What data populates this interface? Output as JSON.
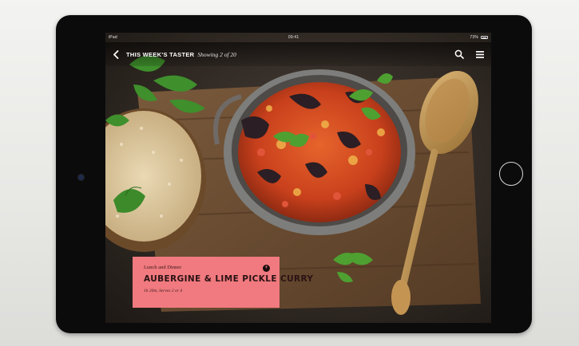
{
  "status_bar": {
    "carrier": "iPad",
    "time": "09:41",
    "battery": "73%"
  },
  "nav": {
    "title": "THIS WEEK'S TASTER",
    "subtitle": "Showing 2 of 20",
    "back_icon": "chevron-left-icon",
    "search_icon": "search-icon",
    "menu_icon": "hamburger-menu-icon"
  },
  "recipe_card": {
    "category": "Lunch and Dinner",
    "title": "AUBERGINE & LIME PICKLE CURRY",
    "meta": "1h 20m, Serves 2 or 4",
    "info_icon": "info-icon",
    "color": "#f07a7f"
  },
  "photo": {
    "subject": "food-photo"
  }
}
